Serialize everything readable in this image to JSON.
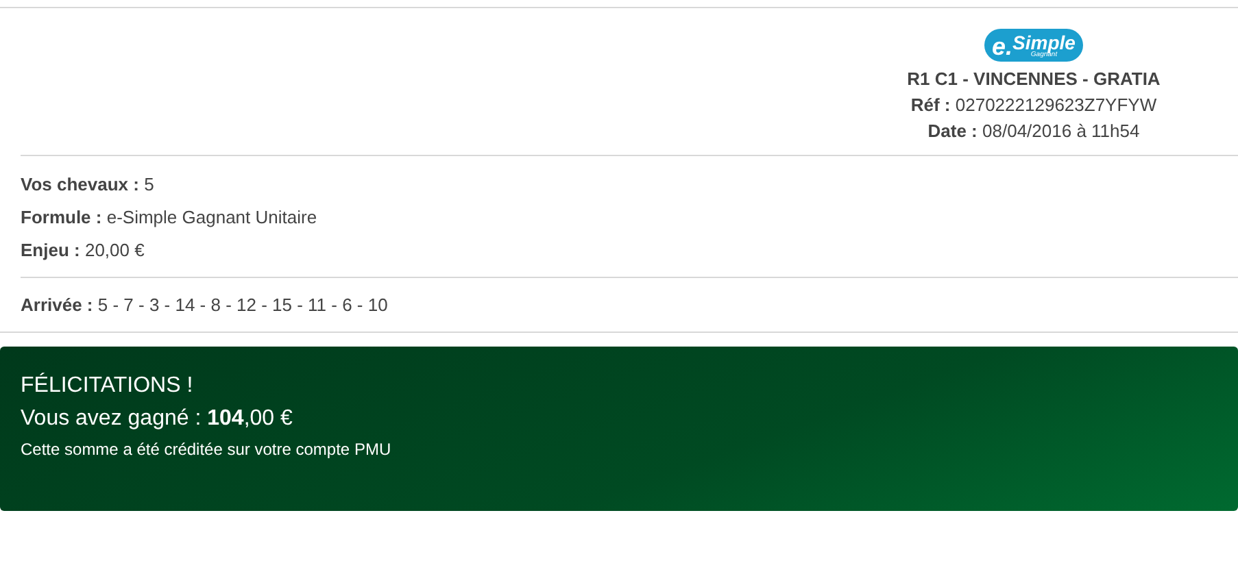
{
  "logo": {
    "mark": "e.",
    "name": "Simple",
    "subtitle": "Gagnant"
  },
  "race": "R1 C1 - VINCENNES - GRATIA",
  "reference": {
    "label": "Réf :",
    "value": "0270222129623Z7YFYW"
  },
  "date": {
    "label": "Date :",
    "value": "08/04/2016 à 11h54"
  },
  "bet_details": [
    {
      "label": "Vos chevaux :",
      "value": "5"
    },
    {
      "label": "Formule :",
      "value": "e-Simple Gagnant Unitaire"
    },
    {
      "label": "Enjeu :",
      "value": "20,00 €"
    }
  ],
  "arrival": {
    "label": "Arrivée :",
    "value": "5 - 7 - 3 - 14 - 8 - 12 - 15 - 11 - 6 - 10"
  },
  "result": {
    "title": "FÉLICITATIONS !",
    "winnings": "Vous avez gagné : **104**,00 €",
    "note": "Cette somme a été créditée sur votre compte PMU"
  }
}
